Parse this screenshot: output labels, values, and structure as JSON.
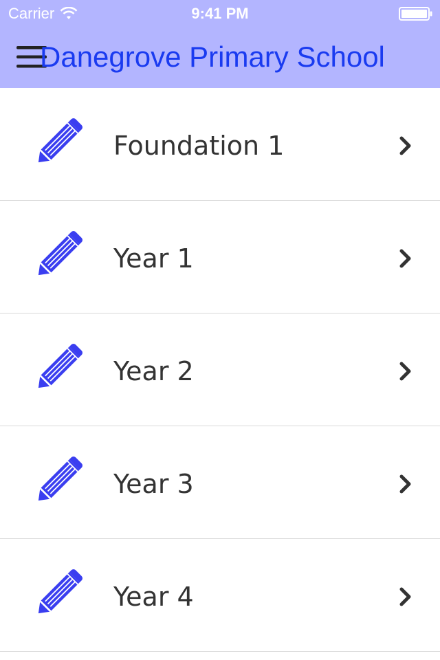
{
  "status_bar": {
    "carrier": "Carrier",
    "time": "9:41 PM",
    "wifi_icon": "wifi-icon",
    "battery_icon": "battery-icon"
  },
  "nav": {
    "menu_icon": "hamburger-menu-icon",
    "title": "Danegrove Primary School",
    "background_color": "#b3b5ff",
    "title_color": "#1a3bf0"
  },
  "list": {
    "items": [
      {
        "label": "Foundation 1",
        "icon": "pencil-icon"
      },
      {
        "label": "Year 1",
        "icon": "pencil-icon"
      },
      {
        "label": "Year 2",
        "icon": "pencil-icon"
      },
      {
        "label": "Year 3",
        "icon": "pencil-icon"
      },
      {
        "label": "Year 4",
        "icon": "pencil-icon"
      }
    ],
    "icon_color": "#3a3ef0",
    "chevron_icon": "chevron-right-icon"
  }
}
